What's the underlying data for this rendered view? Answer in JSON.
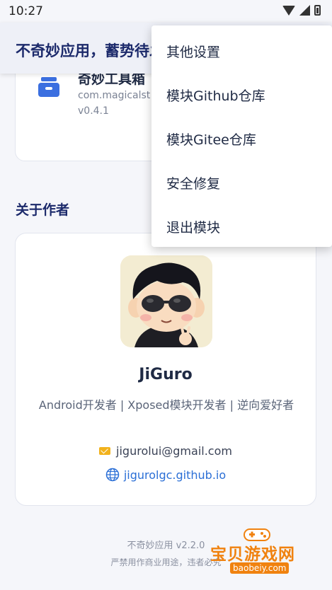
{
  "status_bar": {
    "time": "10:27"
  },
  "app_bar": {
    "title": "不奇妙应用，蓄势待发"
  },
  "module": {
    "name": "奇妙工具箱",
    "package": "com.magicalst",
    "version": "v0.4.1",
    "icon": "toolbox-icon"
  },
  "about_section": {
    "title": "关于作者"
  },
  "author": {
    "name": "JiGuro",
    "bio": "Android开发者 | Xposed模块开发者 | 逆向爱好者",
    "email": "jigurolui@gmail.com",
    "website": "jigurolgc.github.io"
  },
  "footer": {
    "version": "不奇妙应用 v2.2.0",
    "note": "严禁用作商业用途，违者必究"
  },
  "menu": {
    "items": [
      {
        "label": "其他设置"
      },
      {
        "label": "模块Github仓库"
      },
      {
        "label": "模块Gitee仓库"
      },
      {
        "label": "安全修复"
      },
      {
        "label": "退出模块"
      }
    ]
  },
  "watermark": {
    "text": "宝贝游戏网",
    "url": "baobeiy.com"
  },
  "colors": {
    "accent": "#1c2a6b",
    "link": "#2b6fd6",
    "mail_icon": "#f2b21d",
    "module_icon": "#3b6fe0",
    "watermark": "#f0820f"
  }
}
